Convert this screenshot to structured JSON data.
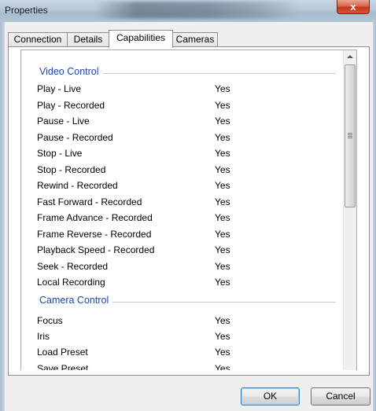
{
  "window": {
    "title": "Properties",
    "close_label": "x"
  },
  "tabs": [
    {
      "label": "Connection"
    },
    {
      "label": "Details"
    },
    {
      "label": "Capabilities"
    },
    {
      "label": "Cameras"
    }
  ],
  "active_tab": "Capabilities",
  "groups": [
    {
      "title": "Video Control",
      "rows": [
        {
          "name": "Play - Live",
          "value": "Yes"
        },
        {
          "name": "Play - Recorded",
          "value": "Yes"
        },
        {
          "name": "Pause - Live",
          "value": "Yes"
        },
        {
          "name": "Pause - Recorded",
          "value": "Yes"
        },
        {
          "name": "Stop - Live",
          "value": "Yes"
        },
        {
          "name": "Stop - Recorded",
          "value": "Yes"
        },
        {
          "name": "Rewind - Recorded",
          "value": "Yes"
        },
        {
          "name": "Fast Forward - Recorded",
          "value": "Yes"
        },
        {
          "name": "Frame Advance - Recorded",
          "value": "Yes"
        },
        {
          "name": "Frame Reverse - Recorded",
          "value": "Yes"
        },
        {
          "name": "Playback Speed - Recorded",
          "value": "Yes"
        },
        {
          "name": "Seek - Recorded",
          "value": "Yes"
        },
        {
          "name": "Local Recording",
          "value": "Yes"
        }
      ]
    },
    {
      "title": "Camera Control",
      "rows": [
        {
          "name": "Focus",
          "value": "Yes"
        },
        {
          "name": "Iris",
          "value": "Yes"
        },
        {
          "name": "Load Preset",
          "value": "Yes"
        },
        {
          "name": "Save Preset",
          "value": "Yes"
        }
      ]
    }
  ],
  "buttons": {
    "ok": "OK",
    "cancel": "Cancel"
  },
  "colors": {
    "group_title": "#1a47b8",
    "ok_border": "#3c7fb1",
    "close_button": "#c4391c"
  }
}
